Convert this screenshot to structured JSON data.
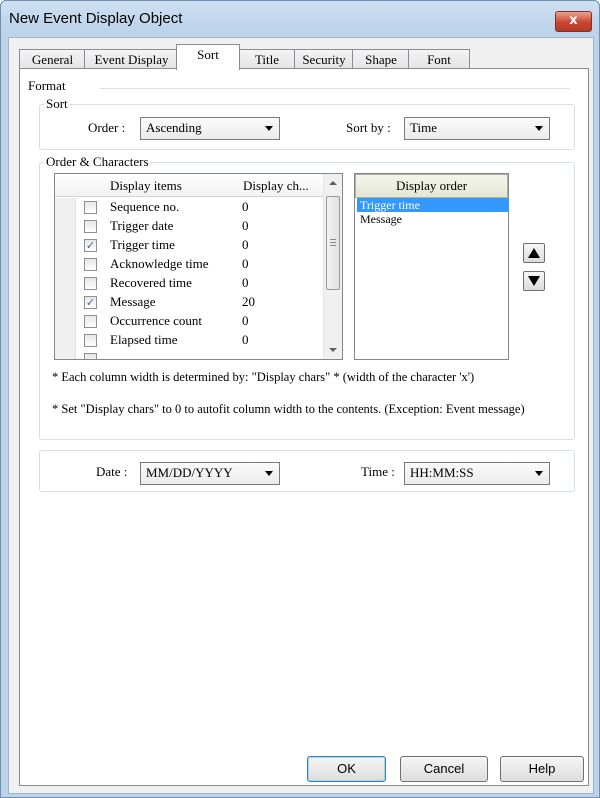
{
  "window": {
    "title": "New Event Display Object",
    "close_label": "x"
  },
  "tabs": [
    {
      "label": "General"
    },
    {
      "label": "Event Display"
    },
    {
      "label": "Sort"
    },
    {
      "label": "Title"
    },
    {
      "label": "Security"
    },
    {
      "label": "Shape"
    },
    {
      "label": "Font"
    }
  ],
  "active_tab": "Sort",
  "format": {
    "label": "Format",
    "sort_group": {
      "title": "Sort",
      "order_label": "Order :",
      "order_value": "Ascending",
      "sortby_label": "Sort by :",
      "sortby_value": "Time"
    },
    "order_chars_group": {
      "title": "Order & Characters",
      "col_items": "Display items",
      "col_chars": "Display ch...",
      "rows": [
        {
          "item": "Sequence no.",
          "chars": "0",
          "checked": false
        },
        {
          "item": "Trigger date",
          "chars": "0",
          "checked": false
        },
        {
          "item": "Trigger time",
          "chars": "0",
          "checked": true
        },
        {
          "item": "Acknowledge time",
          "chars": "0",
          "checked": false
        },
        {
          "item": "Recovered time",
          "chars": "0",
          "checked": false
        },
        {
          "item": "Message",
          "chars": "20",
          "checked": true
        },
        {
          "item": "Occurrence count",
          "chars": "0",
          "checked": false
        },
        {
          "item": "Elapsed time",
          "chars": "0",
          "checked": false
        }
      ],
      "display_order_header": "Display order",
      "display_order": [
        {
          "label": "Trigger time",
          "selected": true
        },
        {
          "label": "Message",
          "selected": false
        }
      ],
      "note1": "* Each column width is determined by: \"Display chars\" * (width of the character 'x')",
      "note2": "* Set \"Display chars\" to 0 to autofit column width to the contents. (Exception: Event message)"
    },
    "date_label": "Date :",
    "date_value": "MM/DD/YYYY",
    "time_label": "Time :",
    "time_value": "HH:MM:SS"
  },
  "buttons": {
    "ok": "OK",
    "cancel": "Cancel",
    "help": "Help"
  },
  "colors": {
    "selection": "#3399ff",
    "title_bar": "#bcd3ea",
    "close_button": "#c9462f"
  },
  "icons": {
    "checked": "✓",
    "up_arrow": "up-triangle",
    "down_arrow": "down-triangle"
  }
}
